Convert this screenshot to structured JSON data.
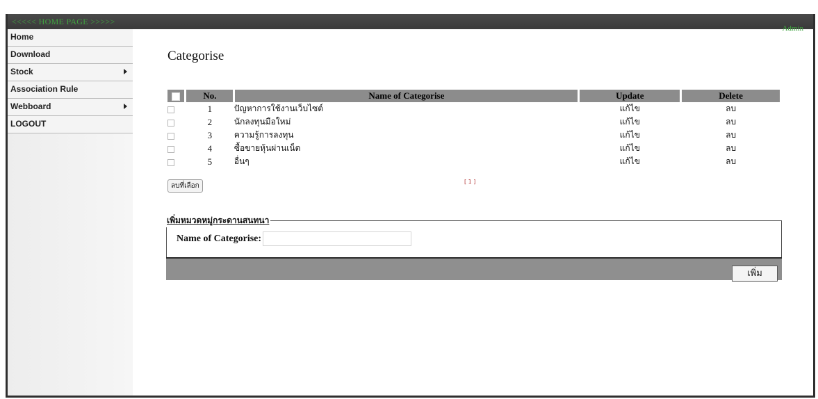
{
  "header": {
    "home_label": "<<<<< HOME PAGE >>>>>",
    "user_label": "Admin"
  },
  "sidebar": {
    "items": [
      {
        "label": "Home",
        "has_submenu": false
      },
      {
        "label": "Download",
        "has_submenu": false
      },
      {
        "label": "Stock",
        "has_submenu": true
      },
      {
        "label": "Association Rule",
        "has_submenu": false
      },
      {
        "label": "Webboard",
        "has_submenu": true
      },
      {
        "label": "LOGOUT",
        "has_submenu": false
      }
    ]
  },
  "main": {
    "title": "Categorise",
    "table": {
      "headers": {
        "no": "No.",
        "name": "Name of Categorise",
        "update": "Update",
        "delete": "Delete"
      },
      "rows": [
        {
          "no": "1",
          "name": "ปัญหาการใช้งานเว็บไซต์",
          "update": "แก้ไข",
          "delete": "ลบ"
        },
        {
          "no": "2",
          "name": "นักลงทุนมือใหม่",
          "update": "แก้ไข",
          "delete": "ลบ"
        },
        {
          "no": "3",
          "name": "ความรู้การลงทุน",
          "update": "แก้ไข",
          "delete": "ลบ"
        },
        {
          "no": "4",
          "name": "ซื้อขายหุ้นผ่านเน็ต",
          "update": "แก้ไข",
          "delete": "ลบ"
        },
        {
          "no": "5",
          "name": "อื่นๆ",
          "update": "แก้ไข",
          "delete": "ลบ"
        }
      ]
    },
    "delete_selected_label": "ลบที่เลือก",
    "pagination": "[ 1 ]",
    "add_form": {
      "legend": "เพิ่มหมวดหมู่กระดานสนทนา",
      "field_label": "Name of Categorise:",
      "field_value": "",
      "submit_label": "เพิ่ม"
    }
  },
  "colors": {
    "header_bar": "#3a3a3a",
    "header_text": "#3fa33f",
    "table_header": "#8c8c8c",
    "pager": "#b03030"
  }
}
